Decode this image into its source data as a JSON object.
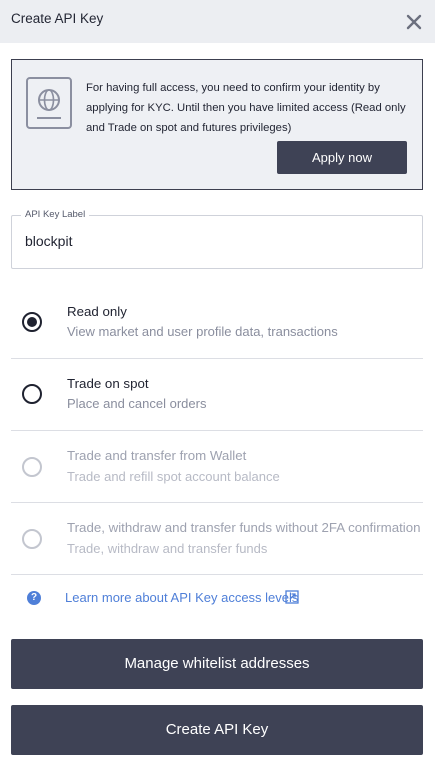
{
  "header": {
    "title": "Create API Key",
    "close_icon": "close-icon"
  },
  "kyc": {
    "icon": "passport-icon",
    "message": "For having full access, you need to confirm your identity by applying for KYC. Until then you have limited access (Read only and Trade on spot and futures privileges)",
    "apply_label": "Apply now"
  },
  "label_field": {
    "legend": "API Key Label",
    "value": "blockpit"
  },
  "options": [
    {
      "title": "Read only",
      "description": "View market and user profile data, transactions",
      "selected": true,
      "enabled": true
    },
    {
      "title": "Trade on spot",
      "description": "Place and cancel orders",
      "selected": false,
      "enabled": true
    },
    {
      "title": "Trade and transfer from Wallet",
      "description": "Trade and refill spot account balance",
      "selected": false,
      "enabled": false
    },
    {
      "title": "Trade, withdraw and transfer funds without 2FA confirmation",
      "description": "Trade, withdraw and transfer funds",
      "selected": false,
      "enabled": false
    }
  ],
  "learn_more": {
    "icon": "help-icon",
    "label": "Learn more about API Key access levels",
    "external_icon": "external-link-icon"
  },
  "buttons": {
    "whitelist_label": "Manage whitelist addresses",
    "create_label": "Create API Key"
  },
  "colors": {
    "primary": "#3e4255",
    "link": "#4f7fd8",
    "muted": "#8a8e9e",
    "disabled": "#b7bac5"
  }
}
